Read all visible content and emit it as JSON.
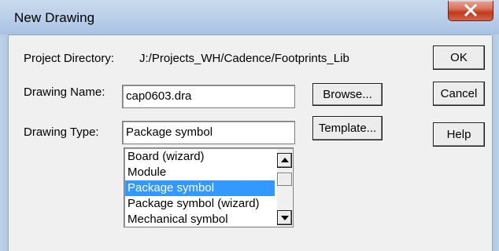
{
  "window": {
    "title": "New Drawing"
  },
  "form": {
    "project_directory_label": "Project Directory:",
    "project_directory_value": "J:/Projects_WH/Cadence/Footprints_Lib",
    "drawing_name_label": "Drawing Name:",
    "drawing_name_value": "cap0603.dra",
    "drawing_type_label": "Drawing Type:",
    "drawing_type_value": "Package symbol"
  },
  "buttons": {
    "ok": "OK",
    "cancel": "Cancel",
    "help": "Help",
    "browse": "Browse...",
    "template": "Template..."
  },
  "drawing_type_list": {
    "items": [
      "Board (wizard)",
      "Module",
      "Package symbol",
      "Package symbol (wizard)",
      "Mechanical symbol"
    ],
    "selected": "Package symbol"
  },
  "colors": {
    "selection": "#3399ff",
    "close_button": "#c2391b"
  }
}
